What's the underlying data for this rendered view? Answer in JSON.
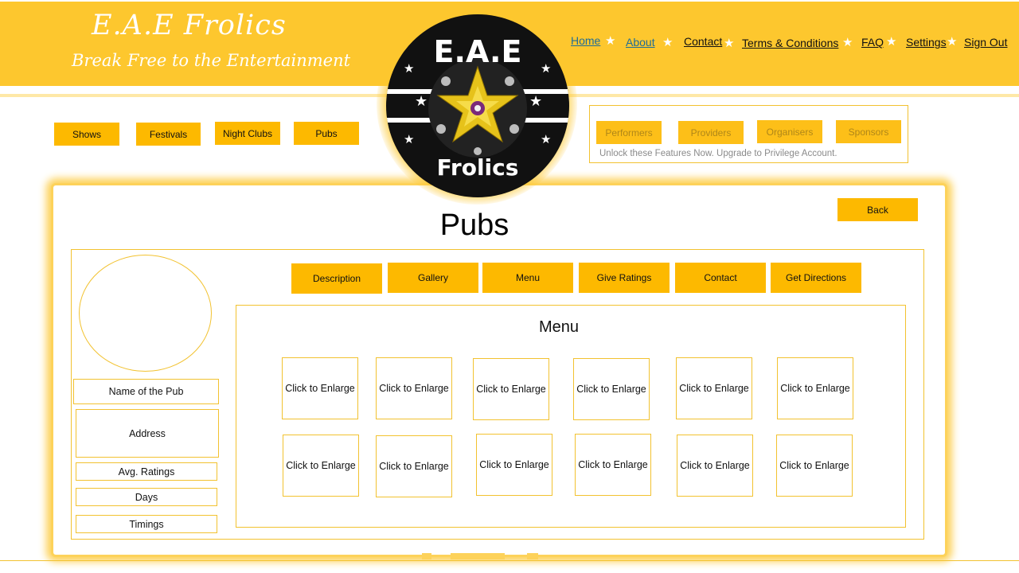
{
  "brand": {
    "title": "E.A.E Frolics",
    "tagline": "Break Free to the Entertainment",
    "logo_top": "E.A.E",
    "logo_bottom": "Frolics"
  },
  "nav": {
    "items": [
      "Home",
      "About",
      "Contact",
      "Terms & Conditions",
      "FAQ",
      "Settings",
      "Sign Out"
    ]
  },
  "categories": [
    "Shows",
    "Festivals",
    "Night Clubs",
    "Pubs"
  ],
  "premium": {
    "buttons": [
      "Performers",
      "Providers",
      "Organisers",
      "Sponsors"
    ],
    "note": "Unlock these Features Now. Upgrade to Privilege Account."
  },
  "page": {
    "title": "Pubs",
    "back_label": "Back"
  },
  "profile": {
    "name": "Name of the Pub",
    "address": "Address",
    "ratings": "Avg. Ratings",
    "days": "Days",
    "timings": "Timings"
  },
  "tabs": [
    "Description",
    "Gallery",
    "Menu",
    "Give Ratings",
    "Contact",
    "Get Directions"
  ],
  "menu_section": {
    "title": "Menu",
    "thumbs": [
      "Click to Enlarge",
      "Click to Enlarge",
      "Click to Enlarge",
      "Click to Enlarge",
      "Click to Enlarge",
      "Click to Enlarge",
      "Click to Enlarge",
      "Click to Enlarge",
      "Click to Enlarge",
      "Click to Enlarge",
      "Click to Enlarge",
      "Click to Enlarge"
    ]
  },
  "colors": {
    "accent": "#fdc72e",
    "button": "#fdb900",
    "border": "#f2c230"
  }
}
